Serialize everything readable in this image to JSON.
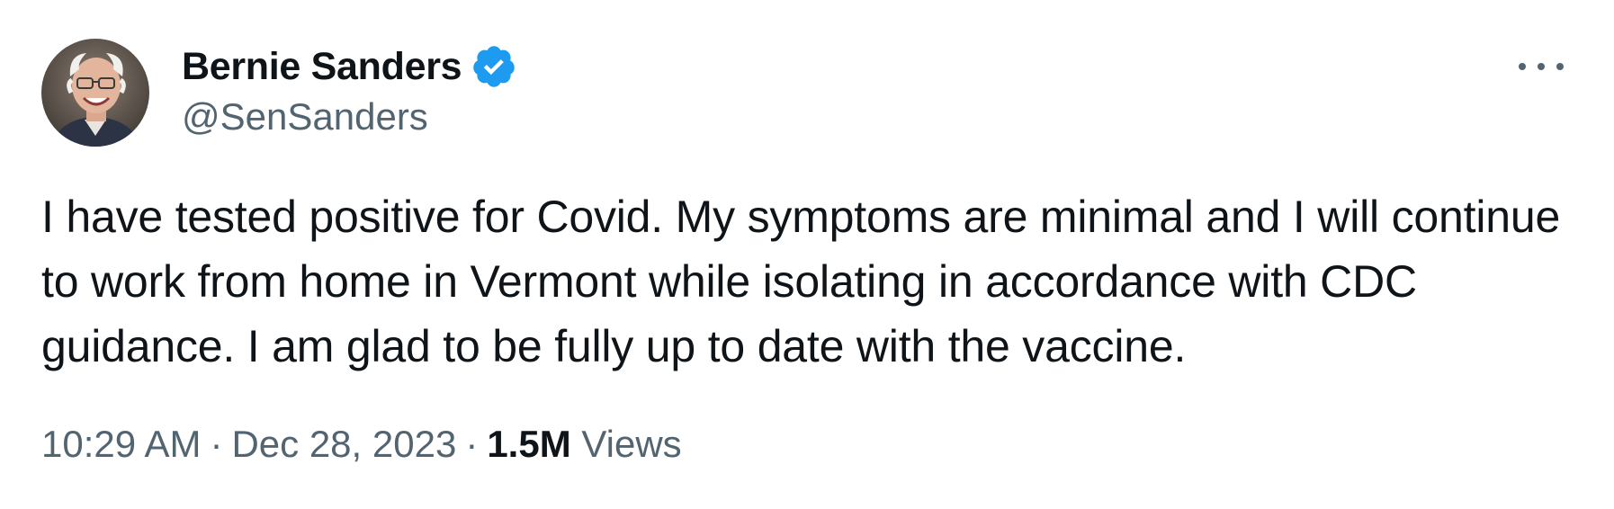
{
  "author": {
    "display_name": "Bernie Sanders",
    "handle": "@SenSanders",
    "verified": true,
    "verified_color": "#1d9bf0",
    "avatar": "profile-photo-smiling-man-glasses"
  },
  "tweet": {
    "text": "I have tested positive for Covid. My symptoms are minimal and I will continue to work from home in Vermont while isolating in accordance with CDC guidance. I am glad to be fully up to date with the vaccine."
  },
  "meta": {
    "time": "10:29 AM",
    "separator": "·",
    "date": "Dec 28, 2023",
    "views_count": "1.5M",
    "views_label": "Views"
  },
  "actions": {
    "more_icon": "more-horizontal-icon"
  },
  "colors": {
    "text_primary": "#0f1419",
    "text_secondary": "#536471",
    "accent": "#1d9bf0"
  }
}
